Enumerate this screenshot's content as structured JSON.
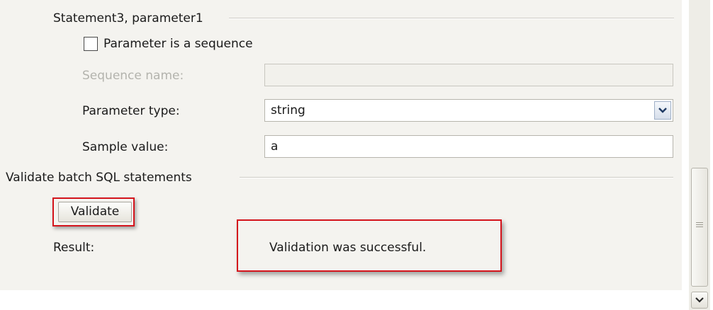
{
  "statement_section": {
    "title": "Statement3, parameter1",
    "sequence_checkbox_label": "Parameter is a sequence",
    "sequence_checkbox_checked": false,
    "sequence_name_label": "Sequence name:",
    "sequence_name_value": "",
    "parameter_type_label": "Parameter type:",
    "parameter_type_value": "string",
    "sample_value_label": "Sample value:",
    "sample_value_value": "a"
  },
  "validate_section": {
    "title": "Validate batch SQL statements",
    "validate_button_label": "Validate",
    "result_label": "Result:",
    "result_text": "Validation was successful."
  },
  "icons": {
    "dropdown": "chevron-down-icon",
    "scroll_down": "chevron-down-icon",
    "scroll_grip": "grip-icon"
  },
  "colors": {
    "highlight": "#d4141c",
    "panel_background": "#f4f3ef"
  }
}
